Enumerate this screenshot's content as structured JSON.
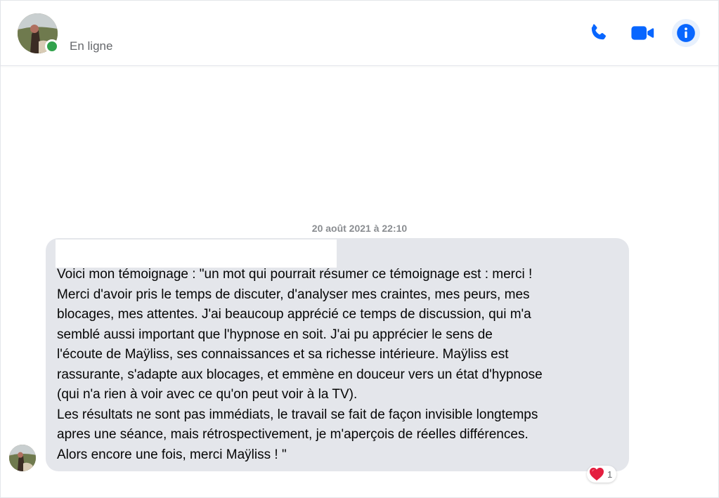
{
  "header": {
    "status": "En ligne",
    "avatar_icon": "profile-photo-icon",
    "actions": [
      {
        "name": "audio-call",
        "icon": "phone-icon"
      },
      {
        "name": "video-call",
        "icon": "video-camera-icon"
      },
      {
        "name": "conversation-info",
        "icon": "info-icon"
      }
    ],
    "accent_color": "#0866ff",
    "online_color": "#31a24c"
  },
  "conversation": {
    "timestamp": "20 août 2021 à 22:10",
    "message": {
      "text": "Voici mon témoignage : \"un mot qui pourrait résumer ce témoignage est : merci !\nMerci d'avoir pris le temps de discuter, d'analyser mes craintes, mes peurs, mes\nblocages, mes attentes. J'ai beaucoup apprécié ce temps de discussion, qui m'a\nsemblé aussi important que l'hypnose en soit. J'ai pu apprécier le sens de\nl'écoute de Maÿliss, ses connaissances et sa richesse intérieure. Maÿliss est\nrassurante, s'adapte aux blocages, et emmène en douceur vers un état d'hypnose\n(qui n'a rien à voir avec ce qu'on peut voir à la TV).\nLes résultats ne sont pas immédiats, le travail se fait de façon invisible longtemps\napres une séance, mais rétrospectivement, je m'aperçois de réelles différences.\nAlors encore une fois, merci Maÿliss ! \"",
      "bubble_color": "#e4e6eb",
      "reaction": {
        "icon": "heart-icon",
        "count": "1",
        "color": "#e41e3f"
      }
    }
  }
}
